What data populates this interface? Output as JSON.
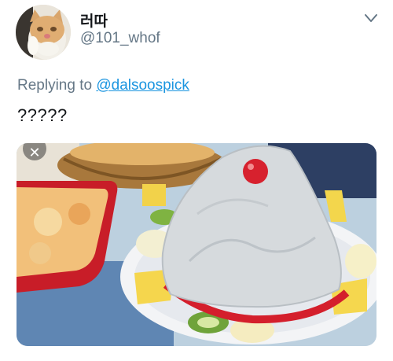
{
  "tweet": {
    "display_name": "러따",
    "handle": "@101_whof",
    "reply_prefix": "Replying to",
    "reply_to": "@dalsoospick",
    "text": "?????"
  },
  "icons": {
    "avatar": "cat-avatar-icon",
    "menu": "chevron-down-icon",
    "media_close": "close-icon"
  },
  "media": {
    "close_glyph": "✕",
    "description_subjects": [
      "shaved-ice dessert with fruit",
      "cheese gratin dish",
      "bread basket"
    ]
  },
  "colors": {
    "link": "#1b95e0",
    "secondary_text": "#657786",
    "primary_text": "#14171a"
  }
}
